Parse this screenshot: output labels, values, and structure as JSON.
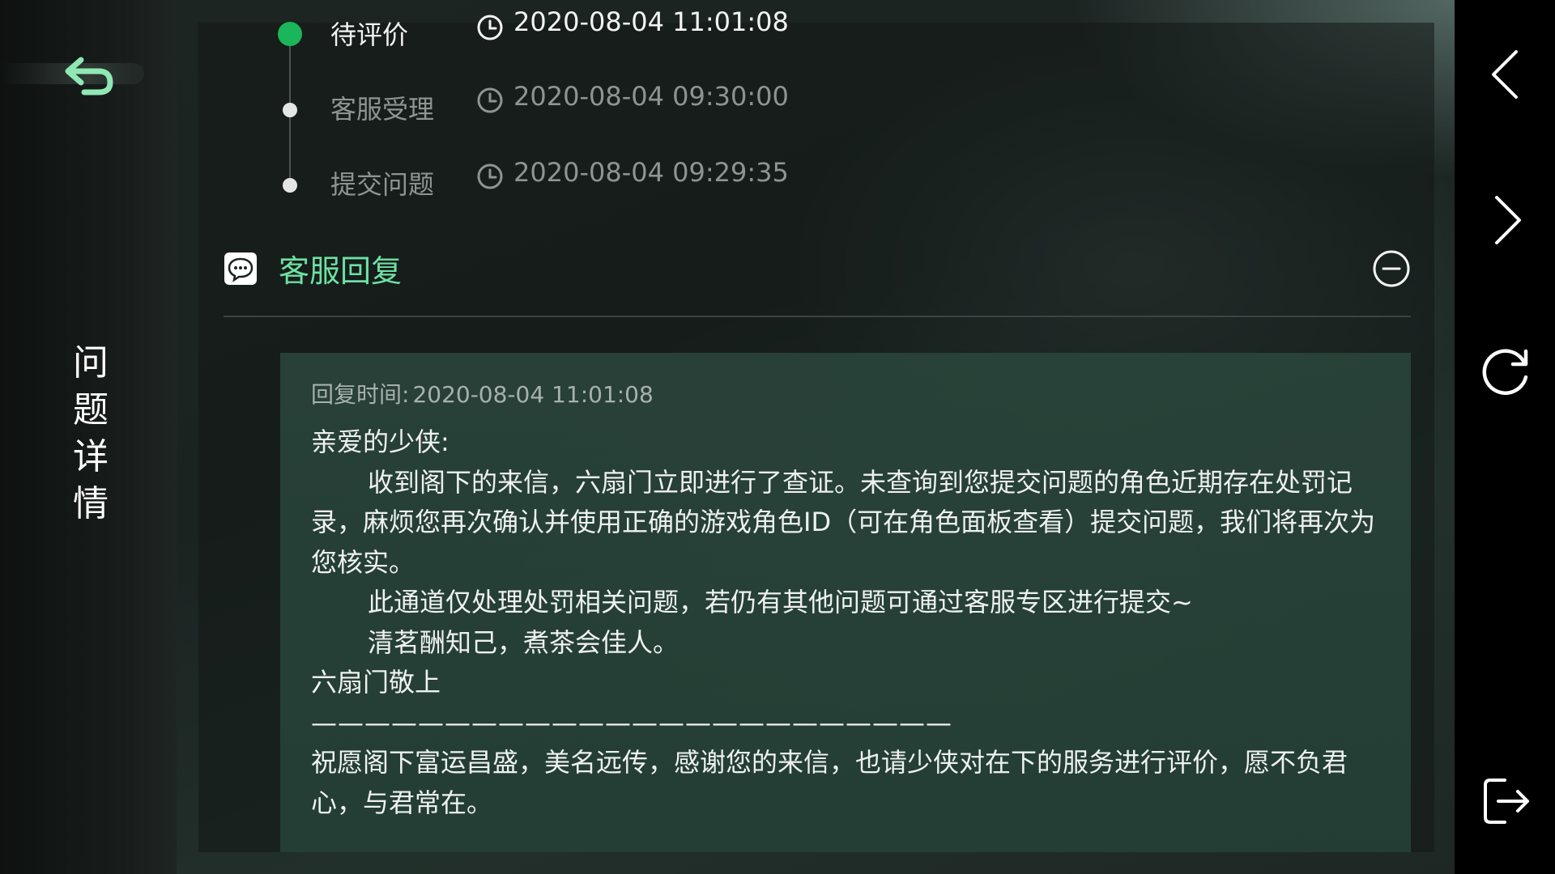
{
  "sidebar": {
    "title_chars": [
      "问",
      "题",
      "详",
      "情"
    ]
  },
  "timeline": [
    {
      "label": "待评价",
      "time": "2020-08-04 11:01:08",
      "active": true
    },
    {
      "label": "客服受理",
      "time": "2020-08-04 09:30:00",
      "active": false
    },
    {
      "label": "提交问题",
      "time": "2020-08-04 09:29:35",
      "active": false
    }
  ],
  "section": {
    "title": "客服回复"
  },
  "reply": {
    "time_label": "回复时间:",
    "time_value": "2020-08-04 11:01:08",
    "greeting": "亲爱的少侠:",
    "para1": "收到阁下的来信，六扇门立即进行了查证。未查询到您提交问题的角色近期存在处罚记录，麻烦您再次确认并使用正确的游戏角色ID（可在角色面板查看）提交问题，我们将再次为您核实。",
    "para2": "此通道仅处理处罚相关问题，若仍有其他问题可通过客服专区进行提交~",
    "para3": "清茗酬知己，煮茶会佳人。",
    "signature": "六扇门敬上",
    "separator": "————————————————————————",
    "closing": "祝愿阁下富运昌盛，美名远传，感谢您的来信，也请少侠对在下的服务进行评价，愿不负君心，与君常在。"
  },
  "colors": {
    "accent_green": "#6ee0a3",
    "status_green": "#1bb55a"
  },
  "icons": {
    "back": "back-arrow-icon",
    "clock": "clock-icon",
    "chat": "chat-bubble-icon",
    "collapse": "minus-circle-icon",
    "nav_prev": "chevron-left-icon",
    "nav_next": "chevron-right-icon",
    "refresh": "refresh-icon",
    "exit": "exit-icon"
  }
}
